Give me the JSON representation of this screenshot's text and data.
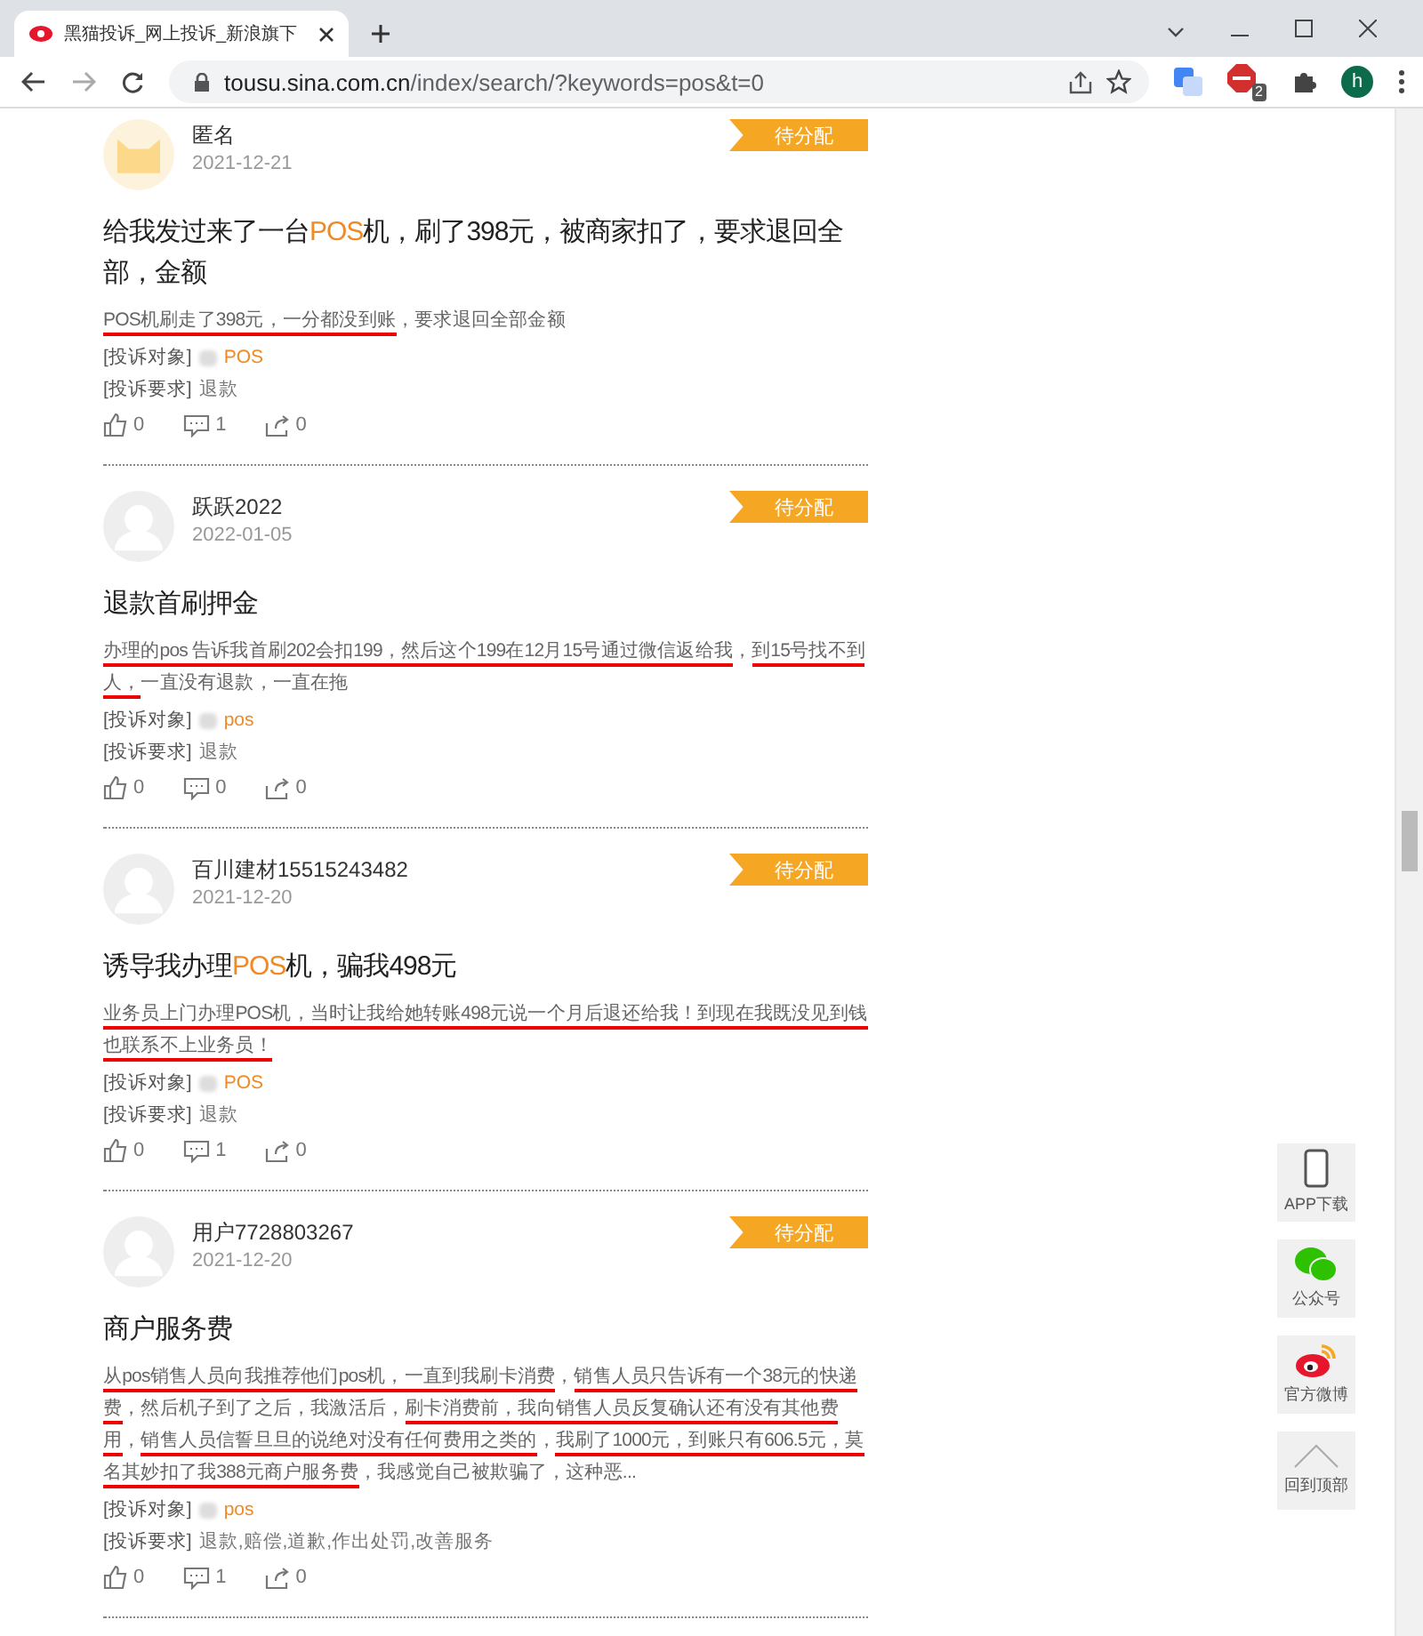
{
  "browser": {
    "tab_title": "黑猫投诉_网上投诉_新浪旗下",
    "url_host": "tousu.sina.com.cn",
    "url_path": "/index/search/?keywords=pos&t=0",
    "adblock_badge": "2",
    "profile_initial": "h"
  },
  "complaints": [
    {
      "avatar": {
        "kind": "cat"
      },
      "author": "匿名",
      "date": "2021-12-21",
      "status": "待分配",
      "title": [
        {
          "text": "给我发过来了一台",
          "highlight": false
        },
        {
          "text": "POS",
          "highlight": true
        },
        {
          "text": "机，刷了398元，被商家扣了，要求退回全部，金额",
          "highlight": false
        }
      ],
      "summary": [
        {
          "text": "POS机刷走了398元，一分都没到账",
          "underlined": true
        },
        {
          "text": "，要求退回全部金额",
          "underlined": false
        }
      ],
      "target_label": "[投诉对象]",
      "target": "POS",
      "request_label": "[投诉要求]",
      "request": "退款",
      "likes": "0",
      "comments": "1",
      "shares": "0"
    },
    {
      "avatar": {
        "kind": "default"
      },
      "author": "跃跃2022",
      "date": "2022-01-05",
      "status": "待分配",
      "title": [
        {
          "text": "退款首刷押金",
          "highlight": false
        }
      ],
      "summary": [
        {
          "text": "办理的pos 告诉我首刷202会扣199，然后这个199在12月15号通过微信返给我",
          "underlined": true
        },
        {
          "text": "，",
          "underlined": false
        },
        {
          "text": "到15号找不到人，",
          "underlined": true
        },
        {
          "text": "一直没有退款，一直在拖",
          "underlined": false
        }
      ],
      "target_label": "[投诉对象]",
      "target": "pos",
      "request_label": "[投诉要求]",
      "request": "退款",
      "likes": "0",
      "comments": "0",
      "shares": "0"
    },
    {
      "avatar": {
        "kind": "default"
      },
      "author": "百川建材15515243482",
      "date": "2021-12-20",
      "status": "待分配",
      "title": [
        {
          "text": "诱导我办理",
          "highlight": false
        },
        {
          "text": "POS",
          "highlight": true
        },
        {
          "text": "机，骗我498元",
          "highlight": false
        }
      ],
      "summary": [
        {
          "text": "业务员上门办理POS机，当时让我给她转账498元说一个月后退还给我！",
          "underlined": true
        },
        {
          "text": "到现在我既没见到钱也联系不上业务员！",
          "underlined": true
        }
      ],
      "target_label": "[投诉对象]",
      "target": "POS",
      "request_label": "[投诉要求]",
      "request": "退款",
      "likes": "0",
      "comments": "1",
      "shares": "0"
    },
    {
      "avatar": {
        "kind": "default"
      },
      "author": "用户7728803267",
      "date": "2021-12-20",
      "status": "待分配",
      "title": [
        {
          "text": "商户服务费",
          "highlight": false
        }
      ],
      "summary": [
        {
          "text": "从",
          "underlined": true
        },
        {
          "text": "pos销售人员向我推荐他们pos机，一直到我刷卡消费",
          "underlined": true
        },
        {
          "text": "，",
          "underlined": false
        },
        {
          "text": "销售人员只告诉有一个38元的快递费",
          "underlined": true
        },
        {
          "text": "，然后机子到了之后，我激活后，",
          "underlined": false
        },
        {
          "text": "刷卡消费前，我向销售人员反复确认还有没有其他费用",
          "underlined": true
        },
        {
          "text": "，",
          "underlined": false
        },
        {
          "text": "销售人员信誓旦旦的说绝对没有任何费用之类的",
          "underlined": true
        },
        {
          "text": "，",
          "underlined": false
        },
        {
          "text": "我刷了1000元，到账只有606.5元，莫名其妙扣了我388元商户服务费",
          "underlined": true
        },
        {
          "text": "，我感觉自己被欺骗了，这种恶...",
          "underlined": false
        }
      ],
      "target_label": "[投诉对象]",
      "target": "pos",
      "request_label": "[投诉要求]",
      "request": "退款,赔偿,道歉,作出处罚,改善服务",
      "likes": "0",
      "comments": "1",
      "shares": "0"
    }
  ],
  "side_tools": [
    {
      "kind": "phone",
      "label": "APP下载"
    },
    {
      "kind": "wechat",
      "label": "公众号"
    },
    {
      "kind": "weibo",
      "label": "官方微博"
    },
    {
      "kind": "top",
      "label": "回到顶部"
    }
  ]
}
